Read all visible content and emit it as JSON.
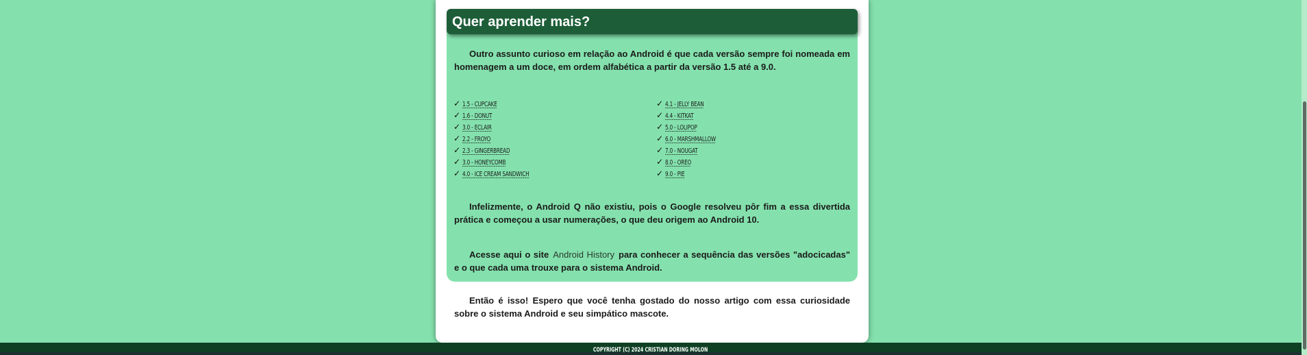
{
  "section": {
    "title": "Quer aprender mais?",
    "intro": "Outro assunto curioso em relação ao Android é que cada versão sempre foi nomeada em homenagem a um doce, em ordem alfabética a partir da versão 1.5 até a 9.0.",
    "check_symbol": "✓",
    "versions_left": [
      "1.5 - Cupcake",
      "1.6 - Donut",
      "3.0 - Eclair",
      "2.2 - Froyo",
      "2.3 - Gingerbread",
      "3.0 - Honeycomb",
      "4.0 - Ice Cream Sandwich"
    ],
    "versions_right": [
      "4.1 - Jelly Bean",
      "4.4 - KitKat",
      "5.0 - Lolipop",
      "6.0 - Marshmallow",
      "7.0 - Nougat",
      "8.0 - Oreo",
      "9.0 - Pie"
    ],
    "android_q_text": "Infelizmente, o Android Q não existiu, pois o Google resolveu pôr fim a essa divertida prática e começou a usar numerações, o que deu origem ao Android 10.",
    "access_before": "Acesse aqui o site",
    "access_link": "Android History",
    "access_after": "para conhecer a sequência das versões \"adocicadas\" e o que cada uma trouxe para o sistema Android."
  },
  "closing": "Então é isso! Espero que você tenha gostado do nosso artigo com essa curiosidade sobre o sistema Android e seu simpático mascote.",
  "footer": {
    "copyright": "Copyright (c) 2024 Cristian Doring Molon"
  },
  "colors": {
    "page_background": "#84e1ad",
    "section_background": "#84e1ad",
    "header_background": "#1d5e38",
    "footer_background": "#0f4024",
    "card_background": "#ffffff"
  }
}
